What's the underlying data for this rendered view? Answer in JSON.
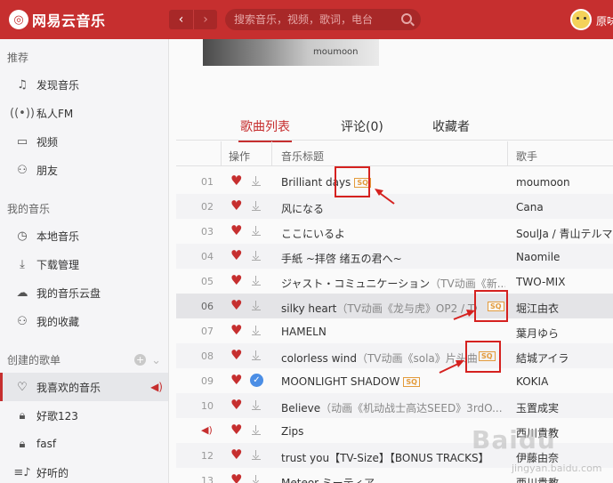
{
  "app": {
    "logo_text": "网易云音乐",
    "search_placeholder": "搜索音乐，视频，歌词，电台",
    "username": "原味"
  },
  "sidebar": {
    "section_recommend": "推荐",
    "recommend_items": [
      {
        "label": "发现音乐",
        "icon": "music-note-icon"
      },
      {
        "label": "私人FM",
        "icon": "radio-icon"
      },
      {
        "label": "视频",
        "icon": "video-icon"
      },
      {
        "label": "朋友",
        "icon": "friends-icon"
      }
    ],
    "section_my_music": "我的音乐",
    "my_music_items": [
      {
        "label": "本地音乐",
        "icon": "local-music-icon"
      },
      {
        "label": "下载管理",
        "icon": "download-icon"
      },
      {
        "label": "我的音乐云盘",
        "icon": "cloud-icon"
      },
      {
        "label": "我的收藏",
        "icon": "collection-icon"
      }
    ],
    "section_created": "创建的歌单",
    "playlists": [
      {
        "label": "我喜欢的音乐",
        "icon": "heart-icon",
        "active": true
      },
      {
        "label": "好歌123",
        "icon": "lock-icon"
      },
      {
        "label": "fasf",
        "icon": "lock-icon"
      },
      {
        "label": "好听的",
        "icon": "playlist-icon"
      }
    ]
  },
  "main": {
    "cover_text": "moumoon",
    "tabs": [
      "歌曲列表",
      "评论(0)",
      "收藏者"
    ],
    "columns": {
      "action": "操作",
      "title": "音乐标题",
      "artist": "歌手"
    },
    "sq_label": "SQ",
    "songs": [
      {
        "num": "01",
        "title": "Brilliant days",
        "sub": "",
        "artist": "moumoon"
      },
      {
        "num": "02",
        "title": "风になる",
        "sub": "",
        "artist": "Cana"
      },
      {
        "num": "03",
        "title": "ここにいるよ",
        "sub": "",
        "artist": "SoulJa / 青山テルマ"
      },
      {
        "num": "04",
        "title": "手紙 ~拝啓 绪五の君へ~",
        "sub": "",
        "artist": "Naomile"
      },
      {
        "num": "05",
        "title": "ジャスト・コミュニケーション",
        "sub": "（TV动画《新...",
        "artist": "TWO-MIX"
      },
      {
        "num": "06",
        "title": "silky heart",
        "sub": "（TV动画《龙与虎》OP2 / TV...",
        "artist": "堀江由衣"
      },
      {
        "num": "07",
        "title": "HAMELN",
        "sub": "",
        "artist": "葉月ゆら"
      },
      {
        "num": "08",
        "title": "colorless wind",
        "sub": "（TV动画《sola》片头曲）",
        "artist": "結城アイラ"
      },
      {
        "num": "09",
        "title": "MOONLIGHT SHADOW",
        "sub": "",
        "artist": "KOKIA"
      },
      {
        "num": "10",
        "title": "Believe",
        "sub": "（动画《机动战士高达SEED》3rdO...",
        "artist": "玉置成実"
      },
      {
        "num": "",
        "title": "Zips",
        "sub": "",
        "artist": "西川貴教"
      },
      {
        "num": "12",
        "title": "trust you【TV-Size】【BONUS TRACKS】",
        "sub": "",
        "artist": "伊藤由奈"
      },
      {
        "num": "13",
        "title": "Meteor-ミーティア-",
        "sub": "",
        "artist": "西川貴教"
      }
    ]
  },
  "watermark": {
    "text": "Baidu",
    "sub": "jingyan.baidu.com"
  }
}
